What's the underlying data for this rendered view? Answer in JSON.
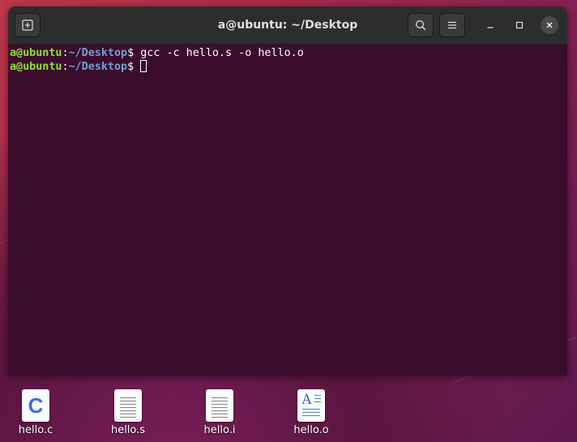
{
  "window": {
    "title": "a@ubuntu: ~/Desktop"
  },
  "terminal": {
    "lines": [
      {
        "user": "a@ubuntu",
        "sep": ":",
        "path": "~/Desktop",
        "prompt": "$ ",
        "command": "gcc -c hello.s -o hello.o"
      },
      {
        "user": "a@ubuntu",
        "sep": ":",
        "path": "~/Desktop",
        "prompt": "$ ",
        "command": ""
      }
    ]
  },
  "desktop": {
    "icons": [
      {
        "label": "hello.c",
        "icon": "c-source-file-icon"
      },
      {
        "label": "hello.s",
        "icon": "text-file-icon"
      },
      {
        "label": "hello.i",
        "icon": "text-file-icon"
      },
      {
        "label": "hello.o",
        "icon": "object-file-icon"
      }
    ]
  },
  "colors": {
    "terminal_bg": "#3c0c2c",
    "titlebar_bg": "#2d2d2d",
    "prompt_user": "#8ae234",
    "prompt_path": "#729fcf"
  }
}
